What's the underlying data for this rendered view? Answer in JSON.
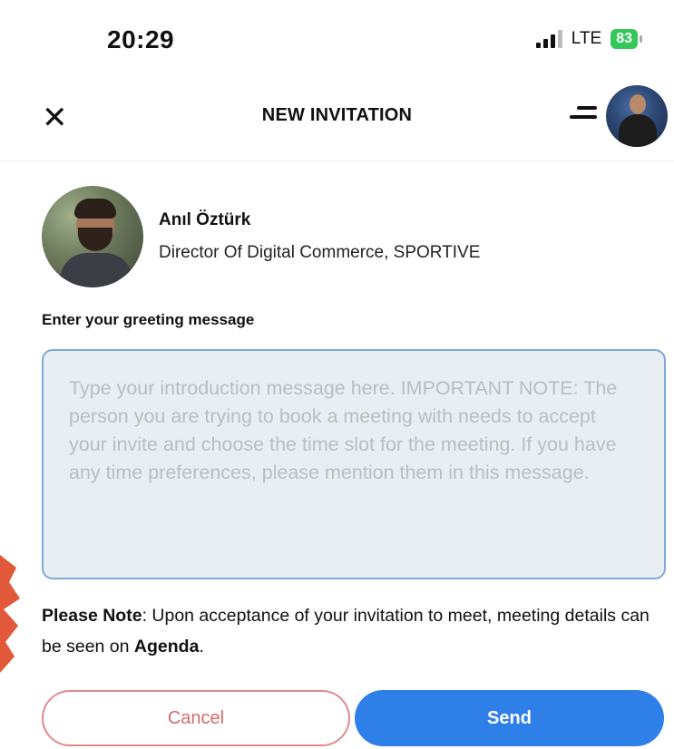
{
  "status_bar": {
    "time": "20:29",
    "network": "LTE",
    "battery": "83"
  },
  "header": {
    "title": "NEW INVITATION",
    "close_icon": "close-icon",
    "menu_icon": "menu-icon"
  },
  "profile": {
    "name": "Anıl Öztürk",
    "role": "Director Of Digital Commerce, SPORTIVE"
  },
  "greeting": {
    "label": "Enter your greeting message",
    "placeholder": "Type your introduction message here. IMPORTANT NOTE: The person you are trying to book a meeting with needs to accept your invite and choose the time slot for the meeting. If you have any time preferences, please mention them in this message."
  },
  "note": {
    "lead": "Please Note",
    "text": ": Upon acceptance of your invitation to meet, meeting details can be seen on ",
    "link": "Agenda",
    "end": "."
  },
  "actions": {
    "cancel": "Cancel",
    "send": "Send"
  },
  "colors": {
    "accent": "#2f7fe8",
    "cancel_border": "#e08a8a",
    "battery": "#34c759",
    "input_bg": "#e9eef2",
    "input_border": "#7fa8dc"
  }
}
